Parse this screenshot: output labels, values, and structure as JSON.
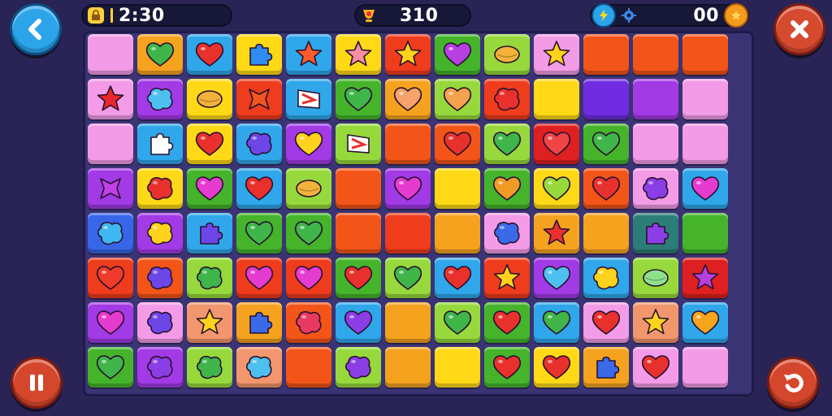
{
  "hud": {
    "timer": "2:30",
    "score": "310",
    "coins": "00"
  },
  "colors": {
    "pink": "#f39be6",
    "orange": "#f5a21f",
    "blue": "#2fa7ea",
    "yellow": "#ffd916",
    "red": "#ef3c1d",
    "green": "#45b42b",
    "lime": "#97d93c",
    "purple": "#a23ae6",
    "redorange": "#f35518",
    "violet": "#6f2ce0",
    "darkred": "#de2020",
    "teal": "#2c7d78",
    "royal": "#3766e8",
    "peach": "#f2966e"
  },
  "board": {
    "rows": [
      [
        [
          "pink",
          "none",
          "#ffffff"
        ],
        [
          "orange",
          "heart",
          "#3fb54a"
        ],
        [
          "blue",
          "heart",
          "#e8312d"
        ],
        [
          "yellow",
          "puzzle",
          "#2f8cf0"
        ],
        [
          "blue",
          "star",
          "#ff5b2b"
        ],
        [
          "yellow",
          "star",
          "#f68fa0"
        ],
        [
          "red",
          "star",
          "#ffd21c"
        ],
        [
          "green",
          "heart",
          "#b640e0"
        ],
        [
          "lime",
          "oval",
          "#f3b23a"
        ],
        [
          "pink",
          "star",
          "#ffd21c"
        ],
        [
          "redorange",
          "none",
          "#ffffff"
        ],
        [
          "redorange",
          "none",
          "#ffffff"
        ],
        [
          "redorange",
          "none",
          "#ffffff"
        ]
      ],
      [
        [
          "pink",
          "star",
          "#e8262b"
        ],
        [
          "purple",
          "blob",
          "#4ec0f0"
        ],
        [
          "yellow",
          "oval",
          "#f3b23a"
        ],
        [
          "red",
          "cross",
          "#f4551e"
        ],
        [
          "blue",
          "flag",
          "#ffffff"
        ],
        [
          "green",
          "heart",
          "#3fb54a"
        ],
        [
          "orange",
          "heart",
          "#f6a26a"
        ],
        [
          "lime",
          "heart",
          "#f4a24d"
        ],
        [
          "red",
          "blob",
          "#e8312d"
        ],
        [
          "yellow",
          "none",
          "#ffffff"
        ],
        [
          "violet",
          "none",
          "#ffffff"
        ],
        [
          "purple",
          "none",
          "#ffffff"
        ],
        [
          "pink",
          "none",
          "#ffffff"
        ]
      ],
      [
        [
          "pink",
          "none",
          "#ffffff"
        ],
        [
          "blue",
          "puzzle",
          "#ffffff"
        ],
        [
          "yellow",
          "heart",
          "#e8312d"
        ],
        [
          "blue",
          "blob",
          "#6d46e8"
        ],
        [
          "purple",
          "heart",
          "#ffd21c"
        ],
        [
          "lime",
          "flag",
          "#ffffff"
        ],
        [
          "redorange",
          "none",
          "#ffffff"
        ],
        [
          "redorange",
          "heart",
          "#e8312d"
        ],
        [
          "lime",
          "heart",
          "#3fb54a"
        ],
        [
          "darkred",
          "heart",
          "#ef4545"
        ],
        [
          "green",
          "heart",
          "#3fb54a"
        ],
        [
          "pink",
          "none",
          "#ffffff"
        ],
        [
          "pink",
          "none",
          "#ffffff"
        ]
      ],
      [
        [
          "purple",
          "cross",
          "#c040e6"
        ],
        [
          "yellow",
          "blob",
          "#e8312d"
        ],
        [
          "green",
          "heart",
          "#e63bd0"
        ],
        [
          "blue",
          "heart",
          "#e8312d"
        ],
        [
          "lime",
          "oval",
          "#f3b23a"
        ],
        [
          "redorange",
          "none",
          "#ffffff"
        ],
        [
          "purple",
          "heart",
          "#e63bd0"
        ],
        [
          "yellow",
          "none",
          "#ffffff"
        ],
        [
          "green",
          "heart",
          "#f09a26"
        ],
        [
          "yellow",
          "heart",
          "#97d93c"
        ],
        [
          "redorange",
          "heart",
          "#e8312d"
        ],
        [
          "pink",
          "blob",
          "#8b3ee6"
        ],
        [
          "blue",
          "heart",
          "#e63bd0"
        ]
      ],
      [
        [
          "royal",
          "blob",
          "#3fb7f0"
        ],
        [
          "purple",
          "blob",
          "#ffd21c"
        ],
        [
          "blue",
          "puzzle",
          "#6d46e8"
        ],
        [
          "green",
          "heart",
          "#3fb54a"
        ],
        [
          "green",
          "heart",
          "#3fb54a"
        ],
        [
          "redorange",
          "none",
          "#ffffff"
        ],
        [
          "red",
          "none",
          "#ffffff"
        ],
        [
          "orange",
          "none",
          "#ffffff"
        ],
        [
          "pink",
          "blob",
          "#3a6ae8"
        ],
        [
          "orange",
          "star",
          "#e8312d"
        ],
        [
          "orange",
          "none",
          "#ffffff"
        ],
        [
          "teal",
          "puzzle",
          "#8b3ee6"
        ],
        [
          "green",
          "none",
          "#ffffff"
        ]
      ],
      [
        [
          "red",
          "heart",
          "#ef3b2b"
        ],
        [
          "redorange",
          "blob",
          "#6d46e8"
        ],
        [
          "lime",
          "blob",
          "#3fb54a"
        ],
        [
          "red",
          "heart",
          "#e63bd0"
        ],
        [
          "red",
          "heart",
          "#e63bd0"
        ],
        [
          "green",
          "heart",
          "#e8312d"
        ],
        [
          "lime",
          "heart",
          "#3fb54a"
        ],
        [
          "blue",
          "heart",
          "#e8312d"
        ],
        [
          "red",
          "star",
          "#ffd21c"
        ],
        [
          "purple",
          "heart",
          "#4ec0f0"
        ],
        [
          "blue",
          "blob",
          "#ffd21c"
        ],
        [
          "lime",
          "oval",
          "#8fe08a"
        ],
        [
          "darkred",
          "star",
          "#b640e0"
        ]
      ],
      [
        [
          "purple",
          "heart",
          "#e63bd0"
        ],
        [
          "pink",
          "blob",
          "#6d46e8"
        ],
        [
          "peach",
          "star",
          "#ffd21c"
        ],
        [
          "orange",
          "puzzle",
          "#3a6ae8"
        ],
        [
          "redorange",
          "blob",
          "#e83a60"
        ],
        [
          "blue",
          "heart",
          "#8b3ee6"
        ],
        [
          "orange",
          "none",
          "#ffffff"
        ],
        [
          "lime",
          "heart",
          "#3fb54a"
        ],
        [
          "green",
          "heart",
          "#e8312d"
        ],
        [
          "blue",
          "heart",
          "#3fb54a"
        ],
        [
          "pink",
          "heart",
          "#e8312d"
        ],
        [
          "peach",
          "star",
          "#ffd21c"
        ],
        [
          "blue",
          "heart",
          "#f6a61e"
        ]
      ],
      [
        [
          "green",
          "heart",
          "#3fb54a"
        ],
        [
          "purple",
          "blob",
          "#8b3ee6"
        ],
        [
          "lime",
          "blob",
          "#3fb54a"
        ],
        [
          "peach",
          "blob",
          "#4ec0f0"
        ],
        [
          "redorange",
          "none",
          "#ffffff"
        ],
        [
          "lime",
          "blob",
          "#8b3ee6"
        ],
        [
          "orange",
          "none",
          "#ffffff"
        ],
        [
          "yellow",
          "none",
          "#ffffff"
        ],
        [
          "green",
          "heart",
          "#e8312d"
        ],
        [
          "yellow",
          "heart",
          "#e8312d"
        ],
        [
          "orange",
          "puzzle",
          "#3a6ae8"
        ],
        [
          "pink",
          "heart",
          "#e8312d"
        ],
        [
          "pink",
          "none",
          "#ffffff"
        ]
      ]
    ]
  }
}
